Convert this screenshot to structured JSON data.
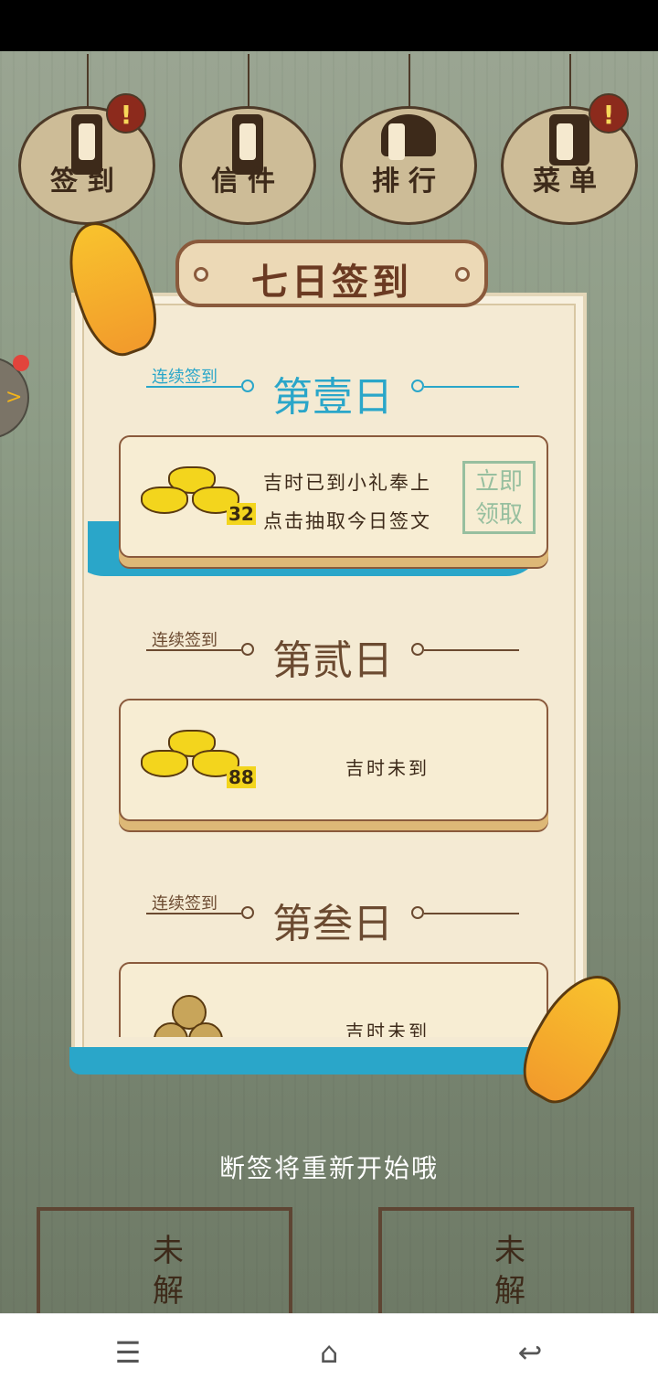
{
  "lanterns": [
    {
      "label": "签到",
      "icon": "lamp-icon",
      "badge": true
    },
    {
      "label": "信件",
      "icon": "letter-icon",
      "badge": false
    },
    {
      "label": "排行",
      "icon": "rank-icon",
      "badge": false
    },
    {
      "label": "菜单",
      "icon": "book-icon",
      "badge": true
    }
  ],
  "badge_symbol": "!",
  "side_arrow": ">",
  "modal": {
    "title": "七日签到",
    "streak_label": "连续签到",
    "days": [
      {
        "name": "第壹日",
        "active": true,
        "reward_count": "32",
        "line1": "吉时已到小礼奉上",
        "line2": "点击抽取今日签文",
        "seal": [
          "立即",
          "领取"
        ]
      },
      {
        "name": "第贰日",
        "active": false,
        "reward_count": "88",
        "status": "吉时未到"
      },
      {
        "name": "第叁日",
        "active": false,
        "status": "吉时未到"
      }
    ]
  },
  "footer_text": "断签将重新开始哦",
  "bottom_tags": [
    "未解",
    "未解"
  ],
  "nav": {
    "menu": "☰",
    "home": "⌂",
    "back": "↩"
  },
  "colors": {
    "accent": "#2aa6c9",
    "brown": "#6b4a30",
    "gold": "#f3d51d",
    "seal": "#97bf9f"
  }
}
